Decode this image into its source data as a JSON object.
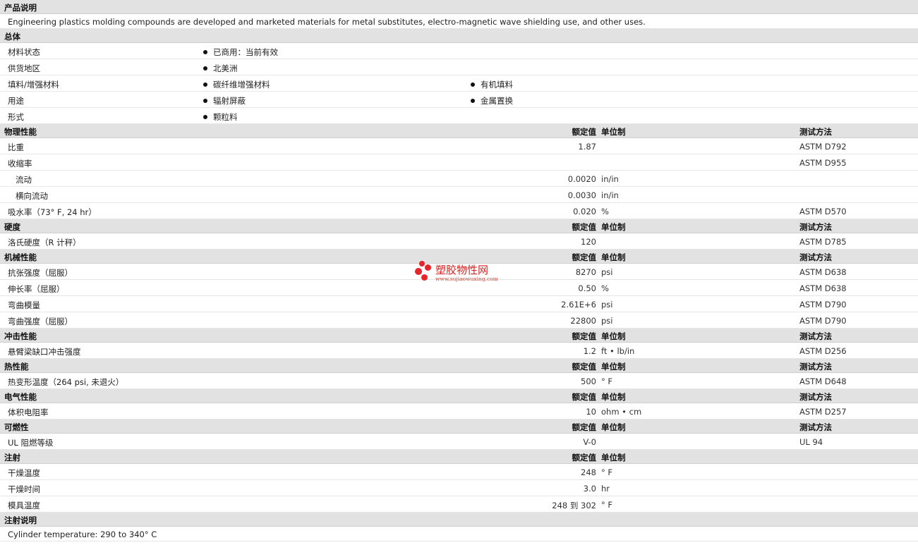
{
  "col_headers": {
    "value": "额定值",
    "unit": "单位制",
    "test": "测试方法"
  },
  "desc": {
    "title": "产品说明",
    "text": "Engineering plastics molding compounds are developed and marketed materials for metal substitutes, electro-magnetic wave shielding use, and other uses."
  },
  "general": {
    "title": "总体",
    "rows": [
      {
        "label": "材料状态",
        "b1": "已商用：当前有效",
        "b2": ""
      },
      {
        "label": "供货地区",
        "b1": "北美洲",
        "b2": ""
      },
      {
        "label": "填料/增强材料",
        "b1": "碳纤维增强材料",
        "b2": "有机填料"
      },
      {
        "label": "用途",
        "b1": "辐射屏蔽",
        "b2": "金属置换"
      },
      {
        "label": "形式",
        "b1": "颗粒料",
        "b2": ""
      }
    ]
  },
  "physical": {
    "title": "物理性能",
    "rows": [
      {
        "label": "比重",
        "value": "1.87",
        "unit": "",
        "test": "ASTM D792"
      },
      {
        "label": "收缩率",
        "value": "",
        "unit": "",
        "test": "ASTM D955"
      },
      {
        "label": "流动",
        "value": "0.0020",
        "unit": "in/in",
        "test": "",
        "sub": true
      },
      {
        "label": "横向流动",
        "value": "0.0030",
        "unit": "in/in",
        "test": "",
        "sub": true
      },
      {
        "label": "吸水率（73°  F, 24 hr）",
        "value": "0.020",
        "unit": "%",
        "test": "ASTM D570"
      }
    ]
  },
  "hardness": {
    "title": "硬度",
    "rows": [
      {
        "label": "洛氏硬度（R 计秤）",
        "value": "120",
        "unit": "",
        "test": "ASTM D785"
      }
    ]
  },
  "mechanical": {
    "title": "机械性能",
    "rows": [
      {
        "label": "抗张强度（屈服）",
        "value": "8270",
        "unit": "psi",
        "test": "ASTM D638"
      },
      {
        "label": "伸长率（屈服）",
        "value": "0.50",
        "unit": "%",
        "test": "ASTM D638"
      },
      {
        "label": "弯曲模量",
        "value": "2.61E+6",
        "unit": "psi",
        "test": "ASTM D790"
      },
      {
        "label": "弯曲强度（屈服）",
        "value": "22800",
        "unit": "psi",
        "test": "ASTM D790"
      }
    ]
  },
  "impact": {
    "title": "冲击性能",
    "rows": [
      {
        "label": "悬臂梁缺口冲击强度",
        "value": "1.2",
        "unit": "ft • lb/in",
        "test": "ASTM D256"
      }
    ]
  },
  "thermal": {
    "title": "热性能",
    "rows": [
      {
        "label": "热变形温度（264 psi, 未退火）",
        "value": "500",
        "unit": "°  F",
        "test": "ASTM D648"
      }
    ]
  },
  "electrical": {
    "title": "电气性能",
    "rows": [
      {
        "label": "体积电阻率",
        "value": "10",
        "unit": "ohm • cm",
        "test": "ASTM D257"
      }
    ]
  },
  "flammability": {
    "title": "可燃性",
    "rows": [
      {
        "label": "UL 阻燃等级",
        "value": "V-0",
        "unit": "",
        "test": "UL 94"
      }
    ]
  },
  "injection": {
    "title": "注射",
    "rows": [
      {
        "label": "干燥温度",
        "value": "248",
        "unit": "°  F",
        "test": ""
      },
      {
        "label": "干燥时间",
        "value": "3.0",
        "unit": "hr",
        "test": ""
      },
      {
        "label": "模具温度",
        "value": "248 到  302",
        "unit": "°  F",
        "test": ""
      }
    ]
  },
  "injection_note": {
    "title": "注射说明",
    "text": "Cylinder temperature: 290 to 340°  C"
  },
  "watermark": {
    "title": "塑胶物性网",
    "url": "www.sujiaowuxing.com"
  }
}
